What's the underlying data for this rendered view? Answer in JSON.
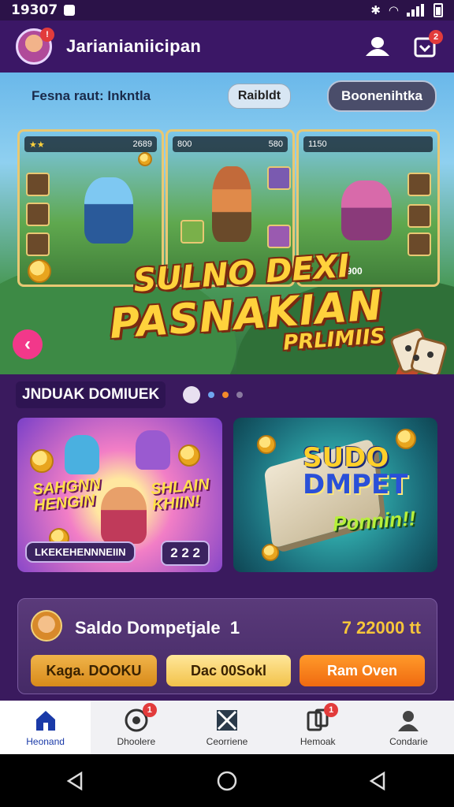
{
  "status_bar": {
    "time": "19307"
  },
  "header": {
    "title": "Jarianianiicipan",
    "avatar_badge": "!",
    "notif_badge": "2"
  },
  "banner": {
    "label": "Fesna raut: Inkntla",
    "chip_mid": "Raibldt",
    "chip_right": "Boonenihtka",
    "promo_line1": "SULNO DEXI",
    "promo_line2": "PASNAKIAN",
    "promo_line3": "PRLIMIIS",
    "panel1_hud": "2689",
    "panel2_hud_left": "800",
    "panel2_hud_right": "580",
    "panel3_hud": "1150",
    "panel3_score": "9900"
  },
  "section": {
    "title": "JNDUAK DOMIUEK"
  },
  "cards": {
    "left_text1": "SAHGNN",
    "left_text2": "HENGIN",
    "left_text3": "SHLAIN",
    "left_text4": "KHIIN!",
    "left_caption": "LKEKEHENNNEIIN",
    "left_badge": "2 2 2",
    "right_title1": "SUDO",
    "right_title2": "DMPET",
    "right_sub": "Ponnin!!"
  },
  "wallet": {
    "label": "Saldo Dompetjale",
    "index": "1",
    "amount": "7 22000 tt",
    "btn1": "Kaga. DOOKU",
    "btn2": "Dac 00Sokl",
    "btn3": "Ram Oven"
  },
  "bottom_nav": {
    "items": [
      {
        "label": "Heonand",
        "icon": "home-icon"
      },
      {
        "label": "Dhoolere",
        "icon": "record-icon",
        "badge": "1"
      },
      {
        "label": "Ceorriene",
        "icon": "crossbox-icon"
      },
      {
        "label": "Hemoak",
        "icon": "cards-icon",
        "badge": "1"
      },
      {
        "label": "Condarie",
        "icon": "person-icon"
      }
    ]
  },
  "colors": {
    "header_bg": "#3b1766",
    "accent_pink": "#f2388a",
    "gold": "#f6c53a",
    "nav_active": "#1a3aa8"
  }
}
